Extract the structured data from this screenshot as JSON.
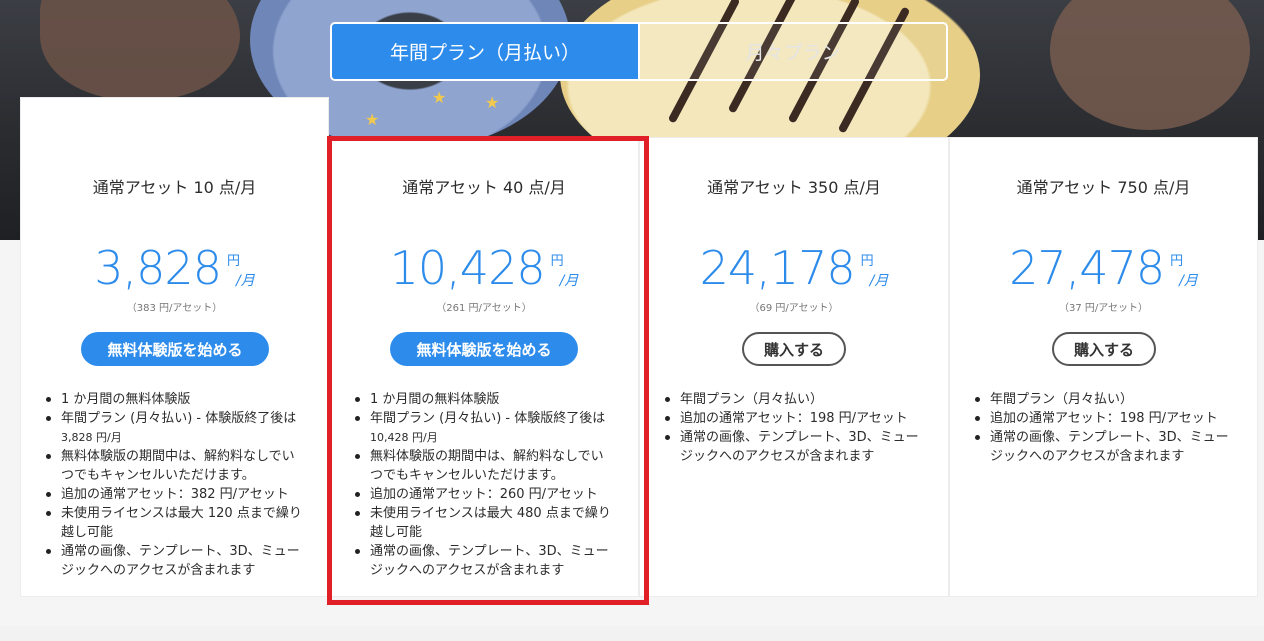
{
  "toggle": {
    "annual_label": "年間プラン（月払い）",
    "monthly_label": "月々プラン"
  },
  "colors": {
    "accent": "#2d8ceb",
    "highlight": "#e01f26"
  },
  "plans": [
    {
      "title": "通常アセット 10 点/月",
      "price": "3,828",
      "yen": "円",
      "per_month": "/月",
      "per_asset": "（383 円/アセット）",
      "cta": "無料体験版を始める",
      "features": [
        "1 か月間の無料体験版",
        "年間プラン (月々払い) - 体験版終了後は",
        "3,828 円/月",
        "無料体験版の期間中は、解約料なしでい",
        "つでもキャンセルいただけます。",
        "追加の通常アセット：382 円/アセット",
        "未使用ライセンスは最大 120 点まで繰り",
        "越し可能",
        "通常の画像、テンプレート、3D、ミュー",
        "ジックへのアクセスが含まれます"
      ]
    },
    {
      "title": "通常アセット 40 点/月",
      "price": "10,428",
      "yen": "円",
      "per_month": "/月",
      "per_asset": "（261 円/アセット）",
      "cta": "無料体験版を始める",
      "features": [
        "1 か月間の無料体験版",
        "年間プラン (月々払い) - 体験版終了後は",
        "10,428 円/月",
        "無料体験版の期間中は、解約料なしでい",
        "つでもキャンセルいただけます。",
        "追加の通常アセット：260 円/アセット",
        "未使用ライセンスは最大 480 点まで繰り",
        "越し可能",
        "通常の画像、テンプレート、3D、ミュー",
        "ジックへのアクセスが含まれます"
      ]
    },
    {
      "title": "通常アセット 350 点/月",
      "price": "24,178",
      "yen": "円",
      "per_month": "/月",
      "per_asset": "（69 円/アセット）",
      "cta": "購入する",
      "features": [
        "年間プラン（月々払い）",
        "追加の通常アセット：198 円/アセット",
        "通常の画像、テンプレート、3D、ミュー",
        "ジックへのアクセスが含まれます"
      ]
    },
    {
      "title": "通常アセット 750 点/月",
      "price": "27,478",
      "yen": "円",
      "per_month": "/月",
      "per_asset": "（37 円/アセット）",
      "cta": "購入する",
      "features": [
        "年間プラン（月々払い）",
        "追加の通常アセット：198 円/アセット",
        "通常の画像、テンプレート、3D、ミュー",
        "ジックへのアクセスが含まれます"
      ]
    }
  ]
}
